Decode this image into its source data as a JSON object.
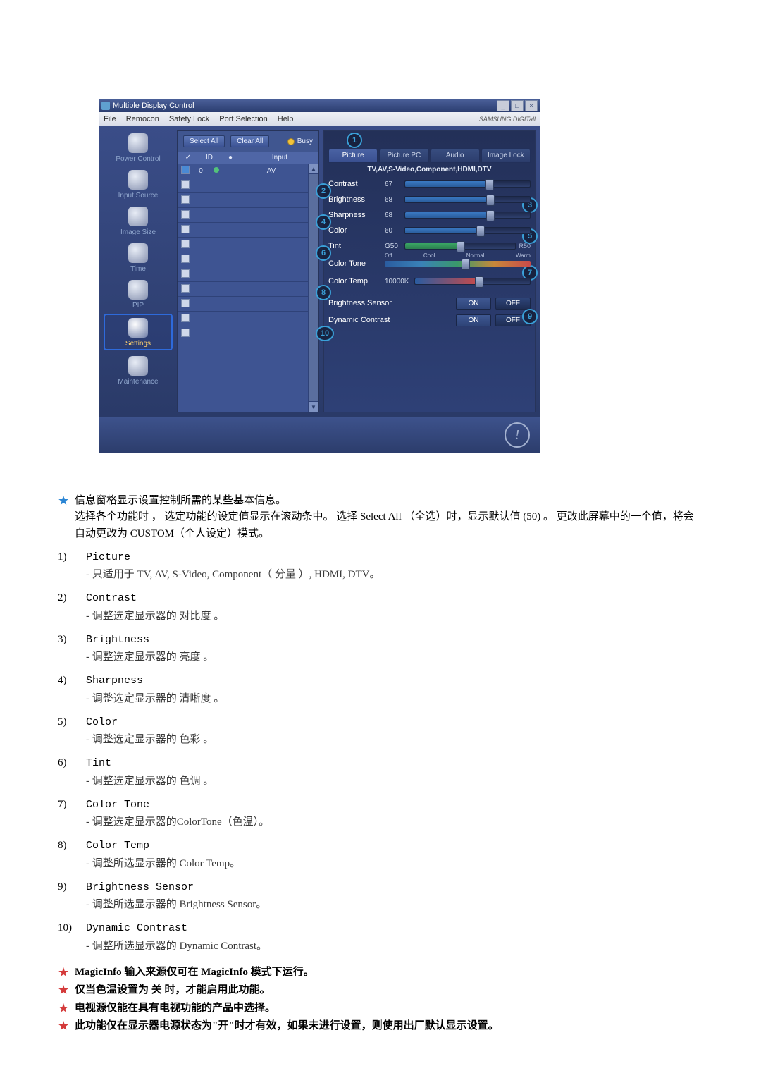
{
  "app": {
    "title": "Multiple Display Control",
    "menus": [
      "File",
      "Remocon",
      "Safety Lock",
      "Port Selection",
      "Help"
    ],
    "brand": "SAMSUNG DIGITall",
    "buttons": {
      "select_all": "Select All",
      "clear_all": "Clear All",
      "busy": "Busy"
    },
    "list_headers": {
      "id": "ID",
      "input": "Input"
    },
    "list_first_row": {
      "id": "0",
      "input": "AV"
    }
  },
  "sidebar": {
    "items": [
      {
        "label": "Power Control"
      },
      {
        "label": "Input Source"
      },
      {
        "label": "Image Size"
      },
      {
        "label": "Time"
      },
      {
        "label": "PIP"
      },
      {
        "label": "Settings"
      },
      {
        "label": "Maintenance"
      }
    ]
  },
  "tabs": [
    "Picture",
    "Picture PC",
    "Audio",
    "Image Lock"
  ],
  "sources_line": "TV,AV,S-Video,Component,HDMI,DTV",
  "controls": {
    "contrast": {
      "label": "Contrast",
      "value": "67",
      "pct": 67
    },
    "brightness": {
      "label": "Brightness",
      "value": "68",
      "pct": 68
    },
    "sharpness": {
      "label": "Sharpness",
      "value": "68",
      "pct": 68
    },
    "color": {
      "label": "Color",
      "value": "60",
      "pct": 60
    },
    "tint": {
      "label": "Tint",
      "left": "G50",
      "right": "R50",
      "pct": 50
    },
    "color_tone": {
      "label": "Color Tone",
      "opts": [
        "Off",
        "Cool",
        "Normal",
        "Warm"
      ],
      "pct": 55
    },
    "color_temp": {
      "label": "Color Temp",
      "value": "10000K",
      "pct": 55
    },
    "brightness_sensor": {
      "label": "Brightness Sensor",
      "on": "ON",
      "off": "OFF"
    },
    "dynamic_contrast": {
      "label": "Dynamic Contrast",
      "on": "ON",
      "off": "OFF"
    }
  },
  "circled": [
    "1",
    "2",
    "3",
    "4",
    "5",
    "6",
    "7",
    "8",
    "9",
    "10"
  ],
  "doc": {
    "intro_star": "信息窗格显示设置控制所需的某些基本信息。\n选择各个功能时 ， 选定功能的设定值显示在滚动条中。 选择 Select All （全选）时，显示默认值 (50) 。 更改此屏幕中的一个值，将会自动更改为 CUSTOM（个人设定）模式。",
    "items": [
      {
        "n": "1)",
        "title": "Picture",
        "desc": "- 只适用于 TV, AV, S-Video, Component（ 分量 ）, HDMI, DTV。"
      },
      {
        "n": "2)",
        "title": "Contrast",
        "desc": "- 调整选定显示器的 对比度 。"
      },
      {
        "n": "3)",
        "title": "Brightness",
        "desc": "- 调整选定显示器的 亮度 。"
      },
      {
        "n": "4)",
        "title": "Sharpness",
        "desc": "- 调整选定显示器的 清晰度 。"
      },
      {
        "n": "5)",
        "title": "Color",
        "desc": "- 调整选定显示器的 色彩 。"
      },
      {
        "n": "6)",
        "title": "Tint",
        "desc": "- 调整选定显示器的 色调 。"
      },
      {
        "n": "7)",
        "title": "Color Tone",
        "desc": "- 调整选定显示器的ColorTone（色温）。"
      },
      {
        "n": "8)",
        "title": "Color Temp",
        "desc": "- 调整所选显示器的 Color Temp。"
      },
      {
        "n": "9)",
        "title": "Brightness Sensor",
        "desc": "- 调整所选显示器的 Brightness Sensor。"
      },
      {
        "n": "10)",
        "title": "Dynamic Contrast",
        "desc": "- 调整所选显示器的 Dynamic Contrast。"
      }
    ],
    "notes": [
      "MagicInfo 输入来源仅可在 MagicInfo 模式下运行。",
      "仅当色温设置为 关 时，才能启用此功能。",
      "电视源仅能在具有电视功能的产品中选择。",
      "此功能仅在显示器电源状态为\"开\"时才有效，如果未进行设置，则使用出厂默认显示设置。"
    ]
  }
}
